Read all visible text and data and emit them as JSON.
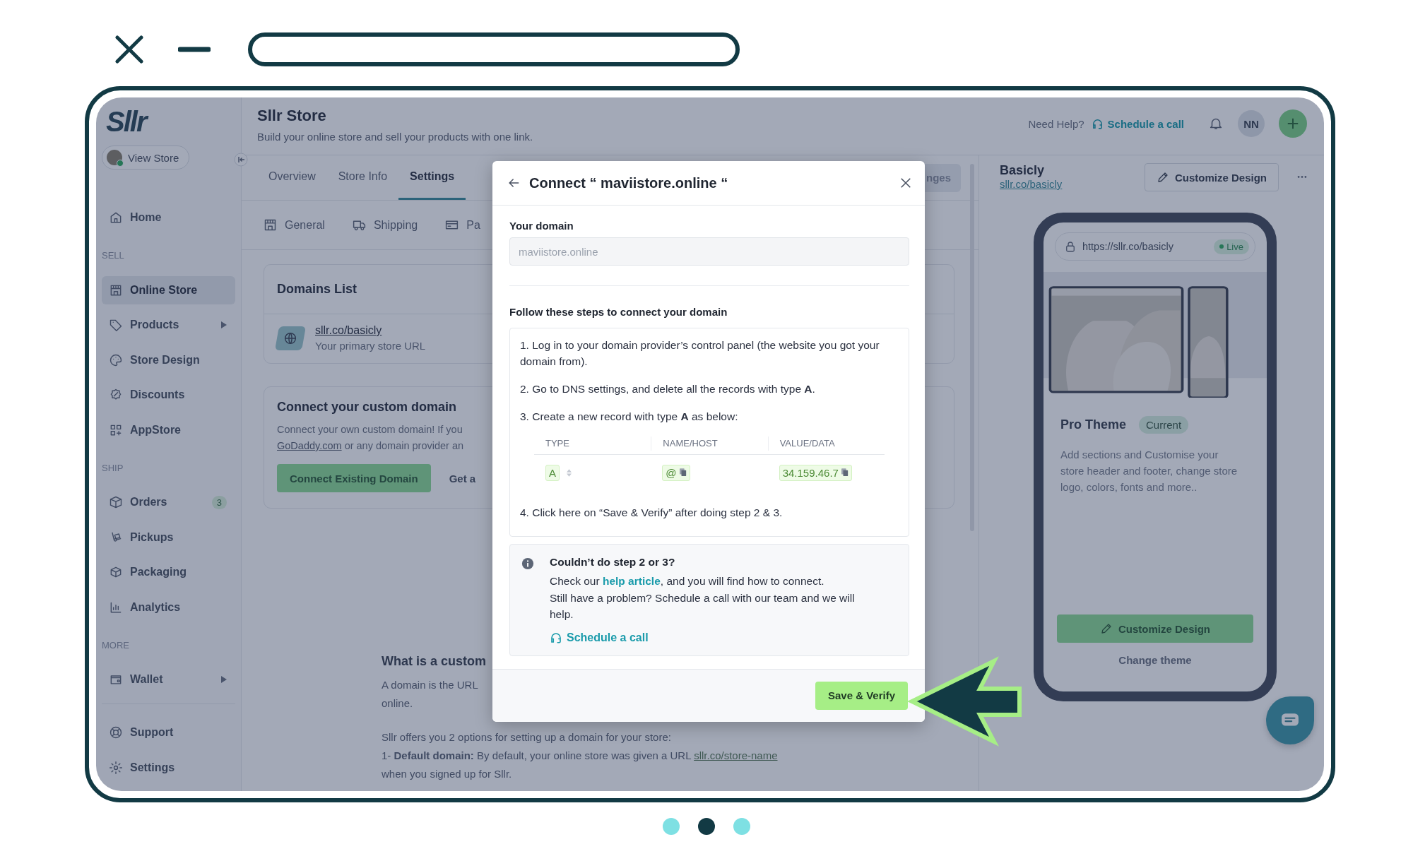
{
  "sidebar": {
    "logo": "Sllr",
    "view_store": "View Store",
    "groups": [
      {
        "items": [
          {
            "label": "Home",
            "kind": "link",
            "selected": false
          }
        ]
      },
      {
        "heading": "SELL",
        "items": [
          {
            "label": "Online Store",
            "kind": "link",
            "selected": true
          },
          {
            "label": "Products",
            "kind": "submenu",
            "selected": false
          },
          {
            "label": "Store Design",
            "kind": "link",
            "selected": false
          },
          {
            "label": "Discounts",
            "kind": "link",
            "selected": false
          },
          {
            "label": "AppStore",
            "kind": "link",
            "selected": false
          }
        ]
      },
      {
        "heading": "SHIP",
        "items": [
          {
            "label": "Orders",
            "kind": "link",
            "selected": false,
            "badge": "3"
          },
          {
            "label": "Pickups",
            "kind": "link",
            "selected": false
          },
          {
            "label": "Packaging",
            "kind": "link",
            "selected": false
          },
          {
            "label": "Analytics",
            "kind": "link",
            "selected": false
          }
        ]
      },
      {
        "heading": "MORE",
        "items": [
          {
            "label": "Wallet",
            "kind": "submenu",
            "selected": false
          }
        ]
      },
      {
        "items": [
          {
            "label": "Support",
            "kind": "link",
            "selected": false
          },
          {
            "label": "Settings",
            "kind": "link",
            "selected": false
          }
        ]
      }
    ]
  },
  "header": {
    "title": "Sllr Store",
    "subtitle": "Build your online store and sell your products with one link.",
    "help_label": "Need Help?",
    "help_link": "Schedule a call",
    "avatar": "NN"
  },
  "tabs": [
    {
      "label": "Overview",
      "selected": false
    },
    {
      "label": "Store Info",
      "selected": false
    },
    {
      "label": "Settings",
      "selected": true
    }
  ],
  "action_button": "nges",
  "subtabs": [
    "General",
    "Shipping",
    "Pa"
  ],
  "domains_card": {
    "title": "Domains List",
    "domain": "sllr.co/basicly",
    "caption": "Your primary store URL"
  },
  "custom_domain_card": {
    "title": "Connect your custom domain",
    "line_1": "Connect your own custom domain! If you",
    "link": "GoDaddy.com",
    "line_2": "or any domain provider an",
    "primary": "Connect Existing Domain",
    "secondary": "Get a"
  },
  "info": {
    "heading": "What is a custom",
    "paragraph": "A domain is the URL",
    "paragraph_end": "online.",
    "intro": "Sllr offers you 2 options for setting up a domain for your store:",
    "option": "1- **Default domain:** By default, your online store was given a URL",
    "option_link": "sllr.co/store-name",
    "option_end": "when you signed up for Sllr."
  },
  "theme_panel": {
    "store_name": "Basicly",
    "store_link": "sllr.co/basicly",
    "customize": "Customize Design",
    "preview_url": "https://sllr.co/basicly",
    "status": "Live",
    "theme_name": "Pro Theme",
    "theme_badge": "Current",
    "description": "Add sections and Customise your store header and footer, change store logo, colors, fonts and more..",
    "primary": "Customize Design",
    "secondary": "Change theme"
  },
  "modal": {
    "title": "Connect “ maviistore.online “",
    "domain_label": "Your domain",
    "domain_value": "maviistore.online",
    "domain_disabled": true,
    "steps_heading": "Follow these steps to connect your domain",
    "steps": [
      "1. Log in to your domain provider’s control panel (the website you got your domain from).",
      "2. Go to DNS settings, and delete all the records with type **A**.",
      "3. Create a new record with type **A** as below:",
      "4. Click here on “Save & Verify” after doing step 2 & 3."
    ],
    "record": {
      "columns": [
        "TYPE",
        "NAME/HOST",
        "VALUE/DATA"
      ],
      "type": "A",
      "name": "@",
      "value": "34.159.46.7"
    },
    "help": {
      "title": "Couldn’t do step 2 or 3?",
      "before_link": "Check our ",
      "link": "help article",
      "after_link": ", and you will find how to connect.",
      "line_2": "Still have a problem? Schedule a call with our team and we will help.",
      "schedule": "Schedule a call"
    },
    "submit": "Save & Verify"
  },
  "carousel": [
    {
      "selected": false
    },
    {
      "selected": true
    },
    {
      "selected": false
    }
  ]
}
